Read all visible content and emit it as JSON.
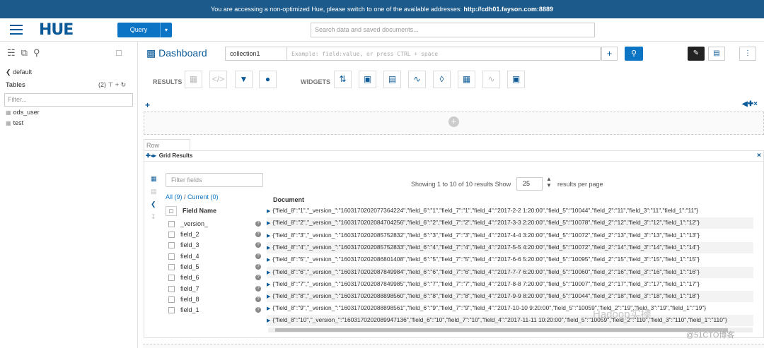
{
  "banner": {
    "text": "You are accessing a non-optimized Hue, please switch to one of the available addresses: ",
    "url": "http://cdh01.fayson.com:8889"
  },
  "topbar": {
    "logo": "HUE",
    "query_label": "Query",
    "query_caret": "▾",
    "search_placeholder": "Search data and saved documents..."
  },
  "sidebar": {
    "icons": [
      "database-icon",
      "copy-icon",
      "search-icon"
    ],
    "db": "default",
    "db_prefix": "❮",
    "tables_label": "Tables",
    "tables_count": "(2) ⊤ + ↻",
    "filter_placeholder": "Filter...",
    "tables": [
      "ods_user",
      "test"
    ]
  },
  "dashboard": {
    "title": "Dashboard",
    "collection": "collection1",
    "query_placeholder": "Example: field:value, or press CTRL + space"
  },
  "toolbar": {
    "results_label": "RESULTS",
    "widgets_label": "WIDGETS"
  },
  "row_label": "Row",
  "widget": {
    "title": "Grid Results",
    "title_controls": "✚◂▸",
    "close": "×",
    "field_filter_placeholder": "Filter fields",
    "all": "All (9)",
    "sep": " / ",
    "current": "Current (0)",
    "field_name_label": "Field Name"
  },
  "fields": [
    "_version_",
    "field_2",
    "field_3",
    "field_4",
    "field_5",
    "field_6",
    "field_7",
    "field_8",
    "field_1"
  ],
  "pagination": {
    "showing": "Showing 1 to 10 of 10 results Show",
    "page_size": "25",
    "per_page": "results per page"
  },
  "document_label": "Document",
  "documents": [
    "{\"field_8\":\"1\",\"_version_\":\"1603170202077364224\",\"field_6\":\"1\",\"field_7\":\"1\",\"field_4\":\"2017-2-2 1:20:00\",\"field_5\":\"10044\",\"field_2\":\"11\",\"field_3\":\"11\",\"field_1\":\"11\"}",
    "{\"field_8\":\"2\",\"_version_\":\"1603170202084704256\",\"field_6\":\"2\",\"field_7\":\"2\",\"field_4\":\"2017-3-3 2:20:00\",\"field_5\":\"10078\",\"field_2\":\"12\",\"field_3\":\"12\",\"field_1\":\"12\"}",
    "{\"field_8\":\"3\",\"_version_\":\"1603170202085752832\",\"field_6\":\"3\",\"field_7\":\"3\",\"field_4\":\"2017-4-4 3:20:00\",\"field_5\":\"10072\",\"field_2\":\"13\",\"field_3\":\"13\",\"field_1\":\"13\"}",
    "{\"field_8\":\"4\",\"_version_\":\"1603170202085752833\",\"field_6\":\"4\",\"field_7\":\"4\",\"field_4\":\"2017-5-5 4:20:00\",\"field_5\":\"10072\",\"field_2\":\"14\",\"field_3\":\"14\",\"field_1\":\"14\"}",
    "{\"field_8\":\"5\",\"_version_\":\"1603170202086801408\",\"field_6\":\"5\",\"field_7\":\"5\",\"field_4\":\"2017-6-6 5:20:00\",\"field_5\":\"10095\",\"field_2\":\"15\",\"field_3\":\"15\",\"field_1\":\"15\"}",
    "{\"field_8\":\"6\",\"_version_\":\"1603170202087849984\",\"field_6\":\"6\",\"field_7\":\"6\",\"field_4\":\"2017-7-7 6:20:00\",\"field_5\":\"10060\",\"field_2\":\"16\",\"field_3\":\"16\",\"field_1\":\"16\"}",
    "{\"field_8\":\"7\",\"_version_\":\"1603170202087849985\",\"field_6\":\"7\",\"field_7\":\"7\",\"field_4\":\"2017-8-8 7:20:00\",\"field_5\":\"10007\",\"field_2\":\"17\",\"field_3\":\"17\",\"field_1\":\"17\"}",
    "{\"field_8\":\"8\",\"_version_\":\"1603170202088898560\",\"field_6\":\"8\",\"field_7\":\"8\",\"field_4\":\"2017-9-9 8:20:00\",\"field_5\":\"10044\",\"field_2\":\"18\",\"field_3\":\"18\",\"field_1\":\"18\"}",
    "{\"field_8\":\"9\",\"_version_\":\"1603170202088898561\",\"field_6\":\"9\",\"field_7\":\"9\",\"field_4\":\"2017-10-10 9:20:00\",\"field_5\":\"10059\",\"field_2\":\"19\",\"field_3\":\"19\",\"field_1\":\"19\"}",
    "{\"field_8\":\"10\",\"_version_\":\"1603170202089947136\",\"field_6\":\"10\",\"field_7\":\"10\",\"field_4\":\"2017-11-11 10:20:00\",\"field_5\":\"10059\",\"field_2\":\"110\",\"field_3\":\"110\",\"field_1\":\"110\"}"
  ],
  "watermark": {
    "main": "Hadoop实操",
    "site": "@51CTO博客"
  },
  "colors": {
    "banner": "#1b5a8a",
    "primary": "#0b74c5",
    "brand": "#0b5a97"
  }
}
